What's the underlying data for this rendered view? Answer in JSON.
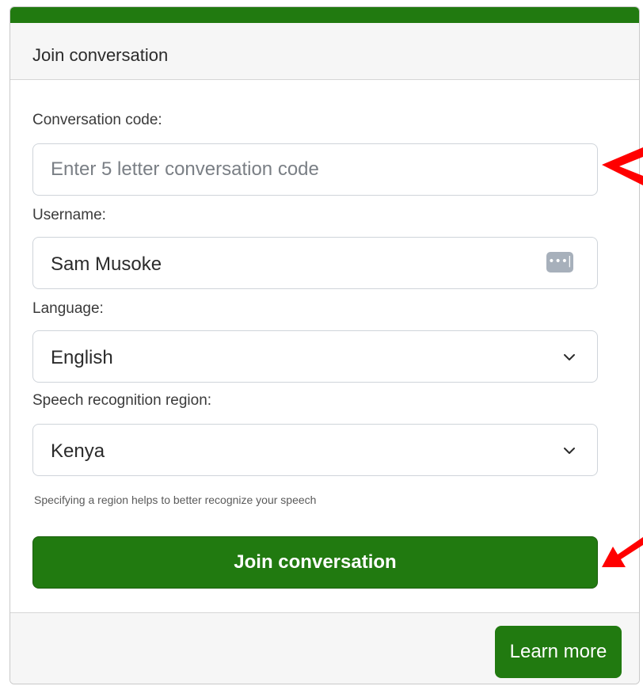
{
  "card": {
    "title": "Join conversation",
    "accent_color": "#217a10"
  },
  "form": {
    "code_label": "Conversation code:",
    "code_placeholder": "Enter 5 letter conversation code",
    "code_value": "",
    "username_label": "Username:",
    "username_value": "Sam Musoke",
    "username_icon": "password-manager-icon",
    "language_label": "Language:",
    "language_value": "English",
    "region_label": "Speech recognition region:",
    "region_value": "Kenya",
    "region_hint": "Specifying a region helps to better recognize your speech",
    "join_label": "Join conversation"
  },
  "footer": {
    "learn_more_label": "Learn more"
  },
  "annotations": {
    "arrow_color": "#ff0000"
  }
}
